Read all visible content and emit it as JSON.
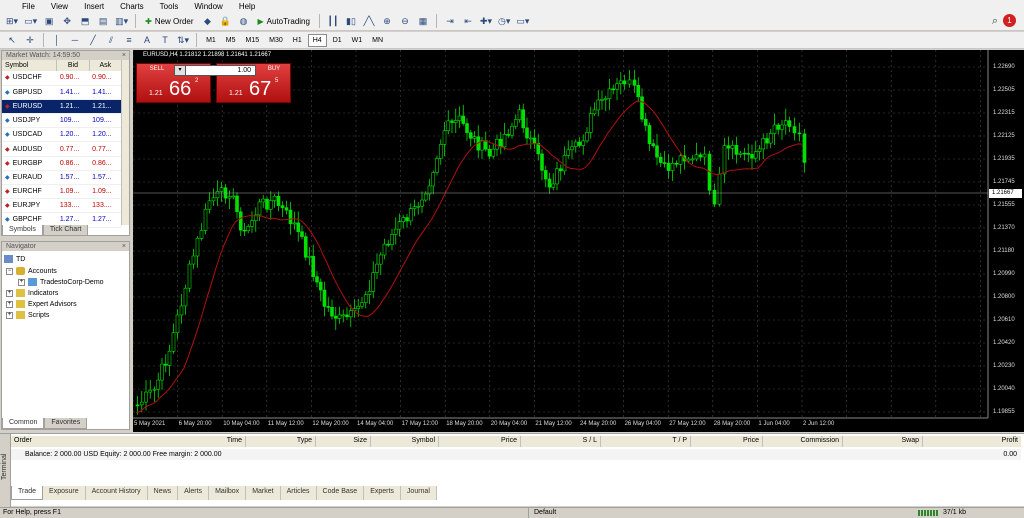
{
  "menu": [
    "File",
    "View",
    "Insert",
    "Charts",
    "Tools",
    "Window",
    "Help"
  ],
  "toolbar": {
    "new_order": "New Order",
    "autotrading": "AutoTrading",
    "timeframes": [
      "M1",
      "M5",
      "M15",
      "M30",
      "H1",
      "H4",
      "D1",
      "W1",
      "MN"
    ],
    "active_timeframe": "H4"
  },
  "market_watch": {
    "title": "Market Watch: 14:59:50",
    "columns": [
      "Symbol",
      "Bid",
      "Ask"
    ],
    "rows": [
      {
        "symbol": "USDCHF",
        "bid": "0.90...",
        "ask": "0.90...",
        "dir": "dn"
      },
      {
        "symbol": "GBPUSD",
        "bid": "1.41...",
        "ask": "1.41...",
        "dir": "up"
      },
      {
        "symbol": "EURUSD",
        "bid": "1.21...",
        "ask": "1.21...",
        "dir": "dn"
      },
      {
        "symbol": "USDJPY",
        "bid": "109....",
        "ask": "109....",
        "dir": "up"
      },
      {
        "symbol": "USDCAD",
        "bid": "1.20...",
        "ask": "1.20...",
        "dir": "up"
      },
      {
        "symbol": "AUDUSD",
        "bid": "0.77...",
        "ask": "0.77...",
        "dir": "dn"
      },
      {
        "symbol": "EURGBP",
        "bid": "0.86...",
        "ask": "0.86...",
        "dir": "dn"
      },
      {
        "symbol": "EURAUD",
        "bid": "1.57...",
        "ask": "1.57...",
        "dir": "up"
      },
      {
        "symbol": "EURCHF",
        "bid": "1.09...",
        "ask": "1.09...",
        "dir": "dn"
      },
      {
        "symbol": "EURJPY",
        "bid": "133....",
        "ask": "133....",
        "dir": "dn"
      },
      {
        "symbol": "GBPCHF",
        "bid": "1.27...",
        "ask": "1.27...",
        "dir": "up"
      }
    ],
    "tabs": [
      "Symbols",
      "Tick Chart"
    ]
  },
  "navigator": {
    "title": "Navigator",
    "root": "TD",
    "accounts": "Accounts",
    "account": "TradestoCorp-Demo",
    "indicators": "Indicators",
    "experts": "Expert Advisors",
    "scripts": "Scripts",
    "tabs": [
      "Common",
      "Favorites"
    ]
  },
  "chart": {
    "title": "EURUSD,H4  1.21812 1.21898 1.21641 1.21667",
    "sell_label": "SELL",
    "buy_label": "BUY",
    "lot": "1.00",
    "sell_prefix": "1.21",
    "sell_big": "66",
    "sell_sup": "2",
    "buy_prefix": "1.21",
    "buy_big": "67",
    "buy_sup": "5",
    "price_tag": "1.21667",
    "y_labels": [
      "1.22690",
      "1.22505",
      "1.22315",
      "1.22125",
      "1.21935",
      "1.21745",
      "1.21555",
      "1.21370",
      "1.21180",
      "1.20990",
      "1.20800",
      "1.20610",
      "1.20420",
      "1.20230",
      "1.20040",
      "1.19855"
    ],
    "x_labels": [
      "5 May 2021",
      "6 May 20:00",
      "10 May 04:00",
      "11 May 12:00",
      "12 May 20:00",
      "14 May 04:00",
      "17 May 12:00",
      "18 May 20:00",
      "20 May 04:00",
      "21 May 12:00",
      "24 May 20:00",
      "26 May 04:00",
      "27 May 12:00",
      "28 May 20:00",
      "1 Jun 04:00",
      "2 Jun 12:00"
    ]
  },
  "terminal": {
    "side_label": "Terminal",
    "columns": [
      "Order",
      "Time",
      "Type",
      "Size",
      "Symbol",
      "Price",
      "S / L",
      "T / P",
      "Price",
      "Commission",
      "Swap",
      "Profit"
    ],
    "balance_line": "Balance: 2 000.00 USD  Equity: 2 000.00  Free margin: 2 000.00",
    "balance_total": "0.00",
    "tabs": [
      "Trade",
      "Exposure",
      "Account History",
      "News",
      "Alerts",
      "Mailbox",
      "Market",
      "Articles",
      "Code Base",
      "Experts",
      "Journal"
    ]
  },
  "status": {
    "help": "For Help, press F1",
    "profile": "Default",
    "traffic": "37/1 kb"
  },
  "colors": {
    "bull": "#00e000",
    "bear": "#00e000",
    "ma": "#b01010",
    "grid": "#4a4a4a"
  }
}
